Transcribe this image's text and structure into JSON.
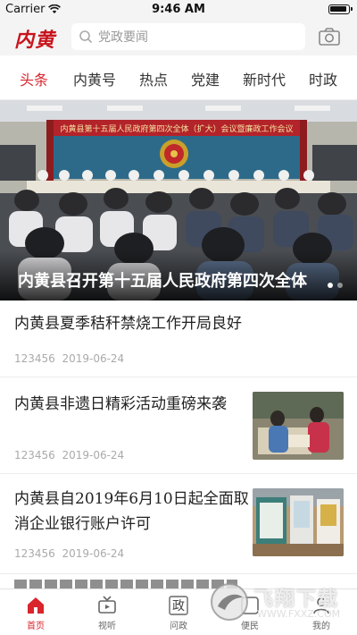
{
  "status_bar": {
    "carrier": "Carrier",
    "time": "9:46 AM"
  },
  "header": {
    "logo": "内黄",
    "search_placeholder": "党政要闻",
    "icons": {
      "search": "search-icon",
      "camera": "camera-icon"
    }
  },
  "tabs": [
    {
      "label": "头条",
      "active": true
    },
    {
      "label": "内黄号"
    },
    {
      "label": "热点"
    },
    {
      "label": "党建"
    },
    {
      "label": "新时代"
    },
    {
      "label": "时政"
    }
  ],
  "hero": {
    "banner_text": "内黄县第十五届人民政府第四次全体（扩大）会议暨廉政工作会议",
    "caption": "内黄县召开第十五届人民政府第四次全体",
    "slide_count": 2,
    "active_slide": 1
  },
  "news": [
    {
      "title": "内黄县夏季秸秆禁烧工作开局良好",
      "source": "123456",
      "date": "2019-06-24",
      "has_thumb": false
    },
    {
      "title": "内黄县非遗日精彩活动重磅来袭",
      "source": "123456",
      "date": "2019-06-24",
      "has_thumb": true
    },
    {
      "title_line1": "内黄县自2019年6月10日起全面取",
      "title_line2": "消企业银行账户许可",
      "source": "123456",
      "date": "2019-06-24",
      "has_thumb": true
    }
  ],
  "bottom_nav": [
    {
      "label": "首页",
      "icon": "home-icon",
      "active": true
    },
    {
      "label": "视听",
      "icon": "tv-icon"
    },
    {
      "label": "问政",
      "icon": "wenzheng-icon",
      "glyph": "政"
    },
    {
      "label": "便民",
      "icon": "service-icon"
    },
    {
      "label": "我的",
      "icon": "profile-icon"
    }
  ],
  "watermark": {
    "title": "飞翔下载",
    "url": "WWW.FXXZ.COM"
  },
  "colors": {
    "accent": "#d9252c",
    "logo": "#c8141d",
    "header_bg": "#f4f4f4"
  }
}
